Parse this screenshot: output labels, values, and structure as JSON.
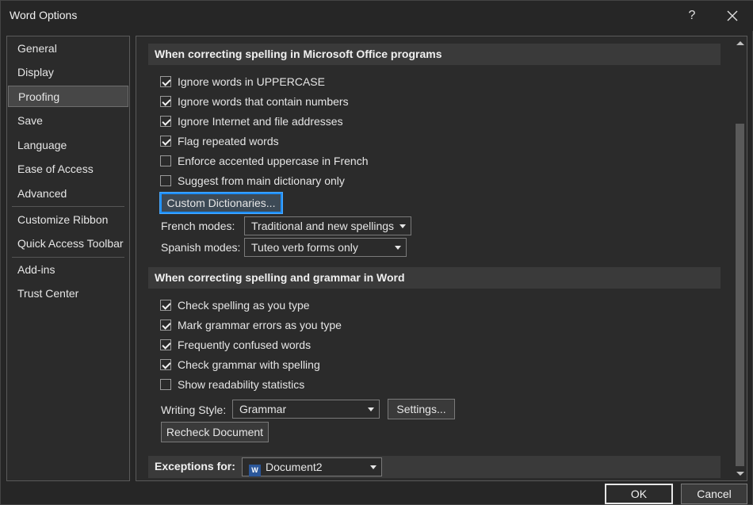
{
  "window": {
    "title": "Word Options",
    "help_glyph": "?",
    "close_icon": "close-icon"
  },
  "sidebar": {
    "items": [
      {
        "label": "General"
      },
      {
        "label": "Display"
      },
      {
        "label": "Proofing",
        "selected": true
      },
      {
        "label": "Save"
      },
      {
        "label": "Language"
      },
      {
        "label": "Ease of Access"
      },
      {
        "label": "Advanced"
      },
      {
        "label": "Customize Ribbon"
      },
      {
        "label": "Quick Access Toolbar"
      },
      {
        "label": "Add-ins"
      },
      {
        "label": "Trust Center"
      }
    ]
  },
  "office_section": {
    "header": "When correcting spelling in Microsoft Office programs",
    "options": [
      {
        "label": "Ignore words in UPPERCASE",
        "checked": true
      },
      {
        "label": "Ignore words that contain numbers",
        "checked": true
      },
      {
        "label": "Ignore Internet and file addresses",
        "checked": true
      },
      {
        "label": "Flag repeated words",
        "checked": true
      },
      {
        "label": "Enforce accented uppercase in French",
        "checked": false
      },
      {
        "label": "Suggest from main dictionary only",
        "checked": false
      }
    ],
    "custom_dictionaries_label": "Custom Dictionaries...",
    "french_modes_label": "French modes:",
    "french_modes_value": "Traditional and new spellings",
    "spanish_modes_label": "Spanish modes:",
    "spanish_modes_value": "Tuteo verb forms only"
  },
  "word_section": {
    "header": "When correcting spelling and grammar in Word",
    "options": [
      {
        "label": "Check spelling as you type",
        "checked": true
      },
      {
        "label": "Mark grammar errors as you type",
        "checked": true
      },
      {
        "label": "Frequently confused words",
        "checked": true
      },
      {
        "label": "Check grammar with spelling",
        "checked": true
      },
      {
        "label": "Show readability statistics",
        "checked": false
      }
    ],
    "writing_style_label": "Writing Style:",
    "writing_style_value": "Grammar",
    "settings_label": "Settings...",
    "recheck_label": "Recheck Document"
  },
  "exceptions": {
    "label": "Exceptions for:",
    "doc_icon_text": "W",
    "value": "Document2"
  },
  "footer": {
    "ok_label": "OK",
    "cancel_label": "Cancel"
  }
}
